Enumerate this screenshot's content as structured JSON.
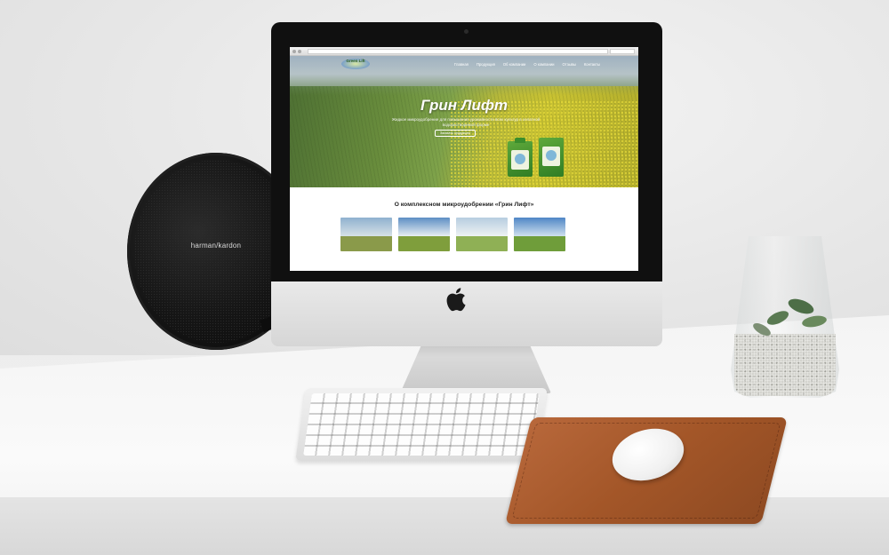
{
  "speaker": {
    "brand": "harman/kardon"
  },
  "site": {
    "logo_text": "Green Lift",
    "nav": [
      "Главная",
      "Продукция",
      "Об компании",
      "О компании",
      "Отзывы",
      "Контакты"
    ],
    "hero_title": "Грин Лифт",
    "hero_subtitle": "Жидкое микроудобрение для повышения урожайности всех культур в хелатной водорастворимой форме",
    "hero_button": "Заказать продукцию",
    "about_title": "О комплексном микроудобрении «Грин Лифт»"
  },
  "colors": {
    "leather": "#a35628",
    "speaker": "#151515",
    "bezel": "#101010",
    "hero_field_green": "#6a8e3d",
    "hero_field_yellow": "#c9c232"
  },
  "icons": {
    "apple_logo": "apple-logo-icon"
  }
}
